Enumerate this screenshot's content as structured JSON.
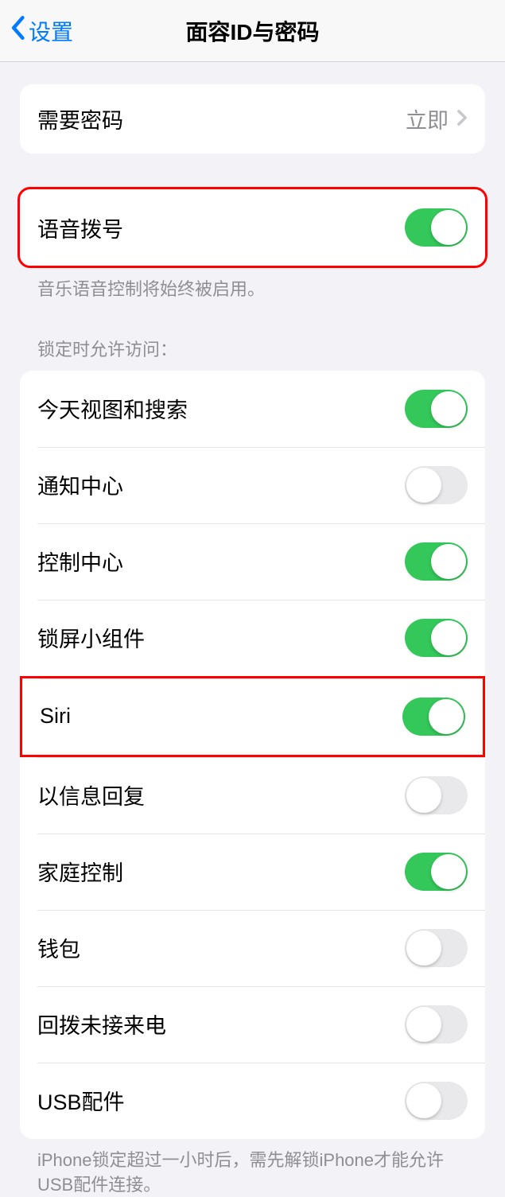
{
  "header": {
    "back_label": "设置",
    "title": "面容ID与密码"
  },
  "require_passcode": {
    "label": "需要密码",
    "value": "立即"
  },
  "voice_dial": {
    "label": "语音拨号",
    "on": true,
    "footer": "音乐语音控制将始终被启用。"
  },
  "lock_access": {
    "header": "锁定时允许访问：",
    "items": [
      {
        "label": "今天视图和搜索",
        "on": true
      },
      {
        "label": "通知中心",
        "on": false
      },
      {
        "label": "控制中心",
        "on": true
      },
      {
        "label": "锁屏小组件",
        "on": true
      },
      {
        "label": "Siri",
        "on": true,
        "highlight": true
      },
      {
        "label": "以信息回复",
        "on": false
      },
      {
        "label": "家庭控制",
        "on": true
      },
      {
        "label": "钱包",
        "on": false
      },
      {
        "label": "回拨未接来电",
        "on": false
      },
      {
        "label": "USB配件",
        "on": false
      }
    ],
    "footer": "iPhone锁定超过一小时后，需先解锁iPhone才能允许USB配件连接。"
  }
}
